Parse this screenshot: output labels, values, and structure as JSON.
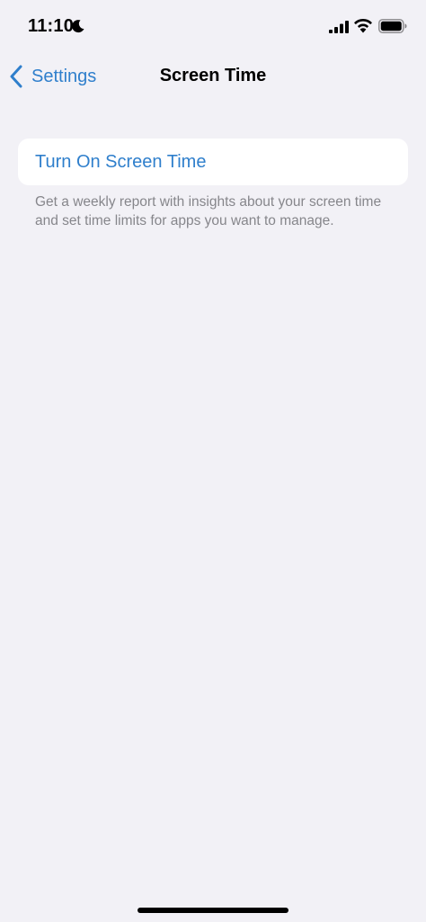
{
  "status_bar": {
    "time": "11:10",
    "icons": [
      "moon-icon",
      "signal-icon",
      "wifi-icon",
      "battery-icon"
    ]
  },
  "nav": {
    "back_label": "Settings",
    "title": "Screen Time"
  },
  "main": {
    "turn_on_label": "Turn On Screen Time",
    "footer": "Get a weekly report with insights about your screen time and set time limits for apps you want to manage."
  },
  "colors": {
    "background": "#f2f1f6",
    "accent": "#2f7fcc",
    "secondary_text": "#86868b",
    "cell_background": "#ffffff"
  }
}
